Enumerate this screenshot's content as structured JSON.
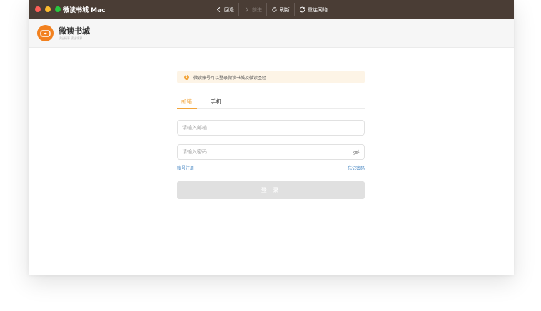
{
  "window": {
    "title": "微读书城 Mac"
  },
  "nav": {
    "back": "回退",
    "forward": "前进",
    "refresh": "刷新",
    "reconnect": "重连网络"
  },
  "header": {
    "brand_title": "微读书城",
    "brand_subtitle": "读出精彩 读出境界"
  },
  "login": {
    "notice": "微读账号可以登录微读书城及微读圣经",
    "tabs": [
      {
        "label": "邮箱",
        "active": true
      },
      {
        "label": "手机",
        "active": false
      }
    ],
    "email_placeholder": "请输入邮箱",
    "password_placeholder": "请输入密码",
    "register_link": "账号注册",
    "forgot_link": "忘记密码",
    "submit_label": "登 录"
  },
  "colors": {
    "titlebar": "#4a3d35",
    "accent": "#f2a43a",
    "logo": "#f2811f",
    "link": "#3b7fbf",
    "button_disabled": "#e0e0e0"
  }
}
